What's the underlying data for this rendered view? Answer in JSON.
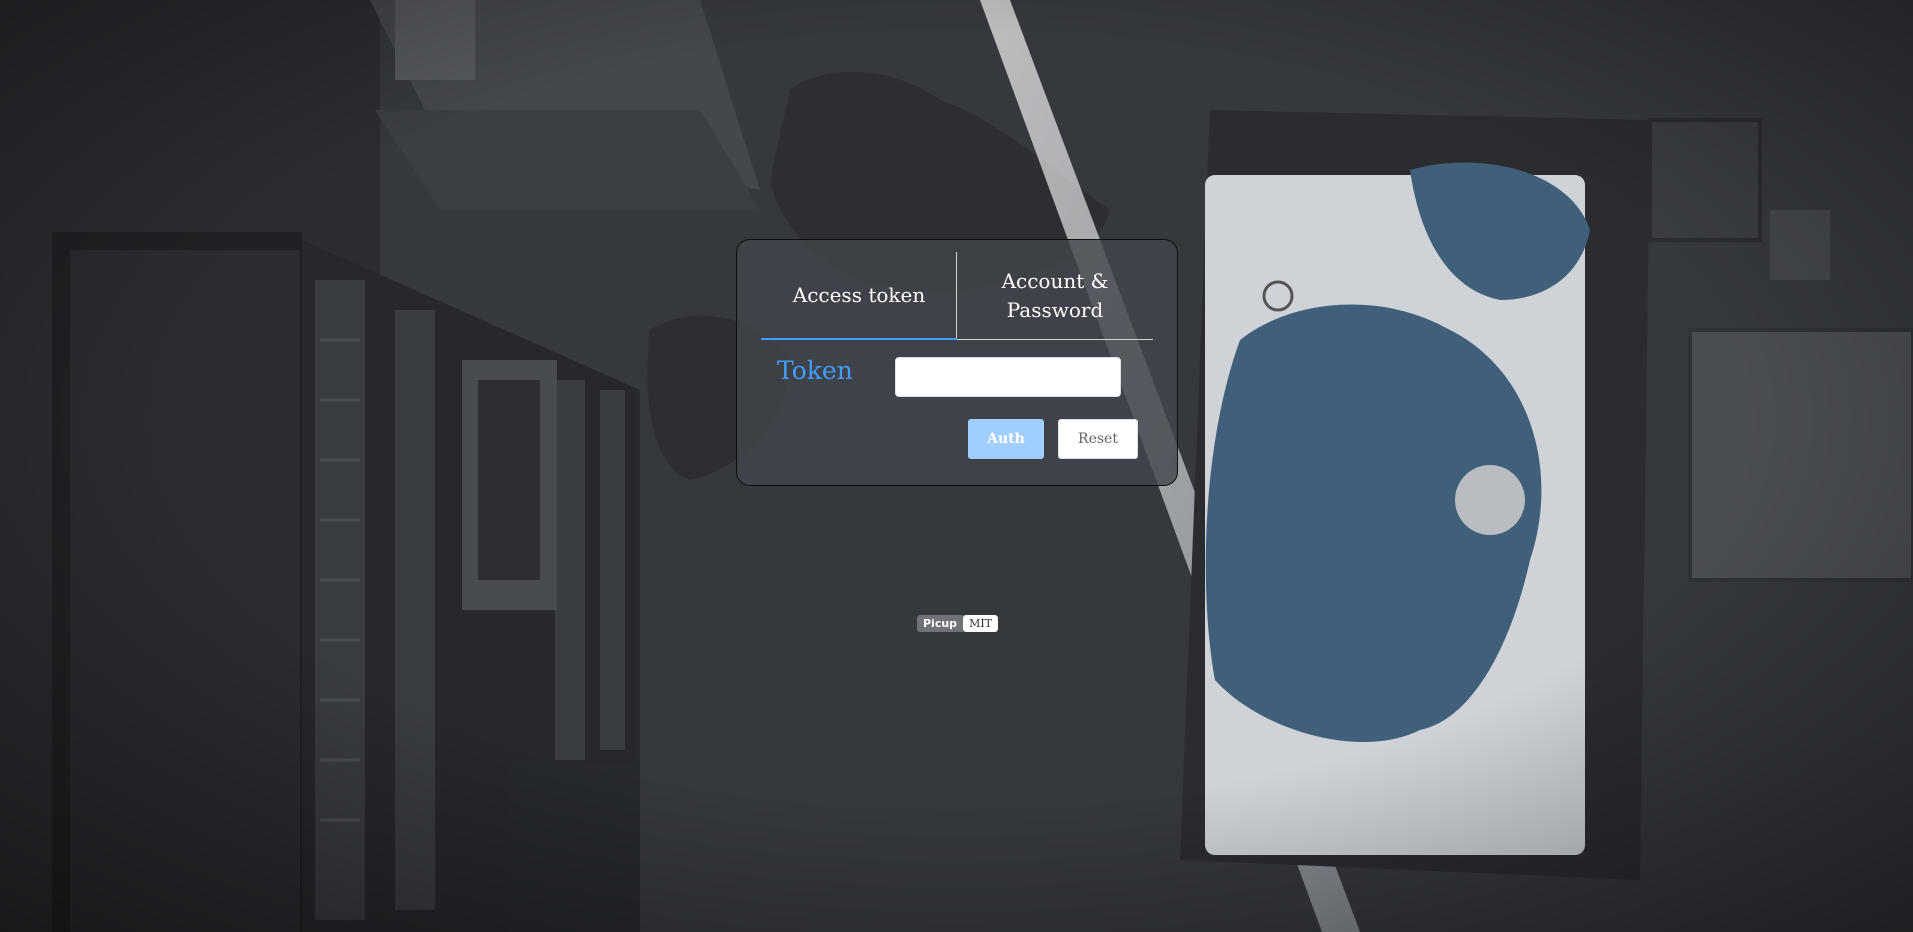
{
  "login": {
    "tabs": [
      {
        "label": "Access token",
        "active": true
      },
      {
        "label": "Account & Password",
        "active": false
      }
    ],
    "token_label": "Token",
    "token_value": "",
    "token_placeholder": "",
    "auth_label": "Auth",
    "reset_label": "Reset"
  },
  "footer": {
    "app_name": "Picup",
    "license": "MIT"
  },
  "colors": {
    "accent": "#409eff",
    "auth_button": "#a0cfff",
    "card_background": "#42464c"
  }
}
